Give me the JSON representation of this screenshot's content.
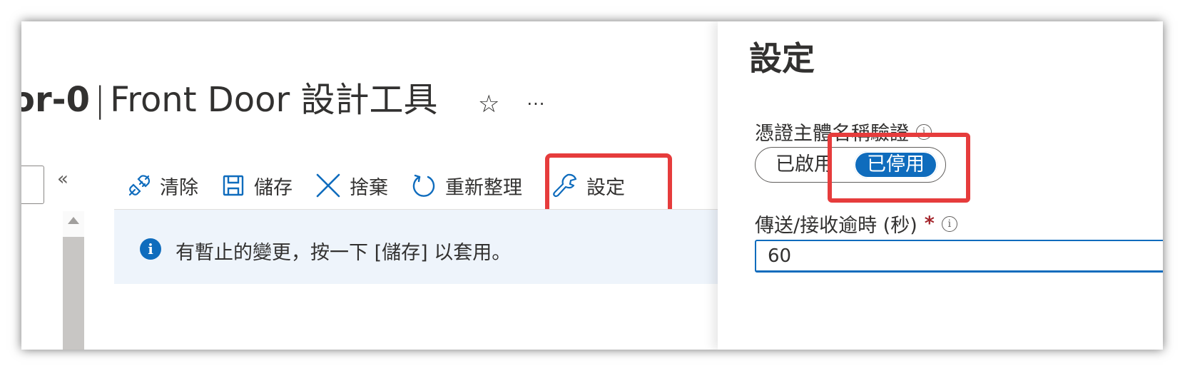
{
  "header": {
    "resource_name": "or-0",
    "separator": "|",
    "page_title": "Front Door 設計工具",
    "favorite_glyph": "☆",
    "more_glyph": "···"
  },
  "nav": {
    "collapse_glyph": "«"
  },
  "toolbar": {
    "items": [
      {
        "label": "清除",
        "icon": "plug-icon"
      },
      {
        "label": "儲存",
        "icon": "save-icon"
      },
      {
        "label": "捨棄",
        "icon": "close-icon"
      },
      {
        "label": "重新整理",
        "icon": "refresh-icon"
      },
      {
        "label": "設定",
        "icon": "wrench-icon"
      }
    ]
  },
  "infobar": {
    "icon_glyph": "i",
    "message": "有暫止的變更，按一下 [儲存] 以套用。"
  },
  "panel": {
    "title": "設定",
    "cert_validation": {
      "label": "憑證主體名稱驗證",
      "info_glyph": "i",
      "option_enabled": "已啟用",
      "option_disabled": "已停用",
      "selected": "已停用"
    },
    "timeout": {
      "label": "傳送/接收逾時 (秒)",
      "required_mark": "*",
      "info_glyph": "i",
      "value": "60"
    }
  },
  "colors": {
    "accent": "#0f6cbd",
    "highlight": "#e63c3c",
    "infobar_bg": "#eef4fb",
    "required": "#a4262c"
  }
}
